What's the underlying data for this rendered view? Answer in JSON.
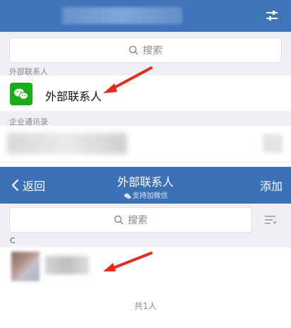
{
  "top": {
    "search_placeholder": "搜索",
    "section_external": "外部联系人",
    "external_item_label": "外部联系人",
    "section_directory": "企业通讯录"
  },
  "bottom": {
    "back_label": "返回",
    "title": "外部联系人",
    "subtitle": "支持加微信",
    "add_label": "添加",
    "search_placeholder": "搜索",
    "index_letter": "C",
    "footer_count": "共1人"
  },
  "colors": {
    "header_blue": "#3f74b8",
    "arrow_red": "#e52b20",
    "wechat_green": "#1aad19"
  },
  "icons": [
    "settings-sliders-icon",
    "search-icon",
    "wechat-icon",
    "chevron-left-icon",
    "sort-list-icon",
    "red-arrow-icon"
  ]
}
